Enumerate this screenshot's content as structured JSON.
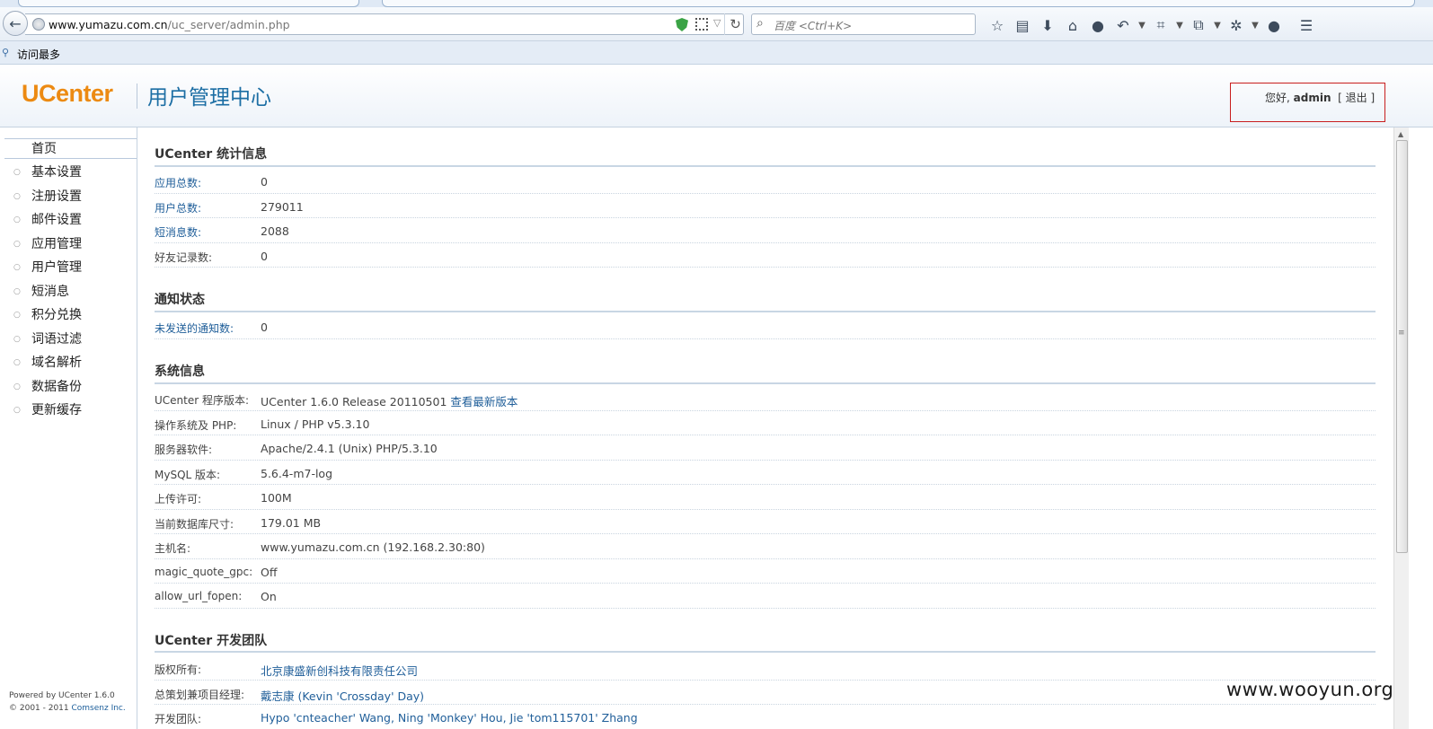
{
  "browser": {
    "url_host": "www.yumazu.com.cn",
    "url_path": "/uc_server/admin.php",
    "search_placeholder": "百度 <Ctrl+K>",
    "bookmark_label": "访问最多"
  },
  "header": {
    "logo": "UCenter",
    "title": "用户管理中心",
    "greeting": "您好,",
    "username": "admin",
    "logout_label": "[ 退出 ]"
  },
  "sidebar": {
    "active_item": "首页",
    "items": [
      "基本设置",
      "注册设置",
      "邮件设置",
      "应用管理",
      "用户管理",
      "短消息",
      "积分兑换",
      "词语过滤",
      "域名解析",
      "数据备份",
      "更新缓存"
    ],
    "powered_line1": "Powered by UCenter 1.6.0",
    "powered_line2_prefix": "© 2001 - 2011 ",
    "powered_line2_company": "Comsenz Inc."
  },
  "stats": {
    "title": "UCenter 统计信息",
    "rows": [
      {
        "label": "应用总数:",
        "value": "0"
      },
      {
        "label": "用户总数:",
        "value": "279011"
      },
      {
        "label": "短消息数:",
        "value": "2088"
      },
      {
        "label": "好友记录数:",
        "value": "0"
      }
    ]
  },
  "notify": {
    "title": "通知状态",
    "rows": [
      {
        "label": "未发送的通知数:",
        "value": "0"
      }
    ]
  },
  "sysinfo": {
    "title": "系统信息",
    "version_label": "UCenter 程序版本:",
    "version_value": "UCenter 1.6.0 Release 20110501",
    "version_link": "查看最新版本",
    "rows": [
      {
        "label": "操作系统及 PHP:",
        "value": "Linux / PHP v5.3.10"
      },
      {
        "label": "服务器软件:",
        "value": "Apache/2.4.1 (Unix) PHP/5.3.10"
      },
      {
        "label": "MySQL 版本:",
        "value": "5.6.4-m7-log"
      },
      {
        "label": "上传许可:",
        "value": "100M"
      },
      {
        "label": "当前数据库尺寸:",
        "value": "179.01 MB"
      },
      {
        "label": "主机名:",
        "value": "www.yumazu.com.cn (192.168.2.30:80)"
      },
      {
        "label": "magic_quote_gpc:",
        "value": "Off"
      },
      {
        "label": "allow_url_fopen:",
        "value": "On"
      }
    ]
  },
  "team": {
    "title": "UCenter 开发团队",
    "rows": [
      {
        "label": "版权所有:",
        "value": "北京康盛新创科技有限责任公司"
      },
      {
        "label": "总策划兼项目经理:",
        "value": "戴志康 (Kevin 'Crossday' Day)"
      },
      {
        "label": "开发团队:",
        "value": "Hypo 'cnteacher' Wang, Ning 'Monkey' Hou, Jie 'tom115701' Zhang"
      }
    ]
  },
  "watermark": "www.wooyun.org"
}
